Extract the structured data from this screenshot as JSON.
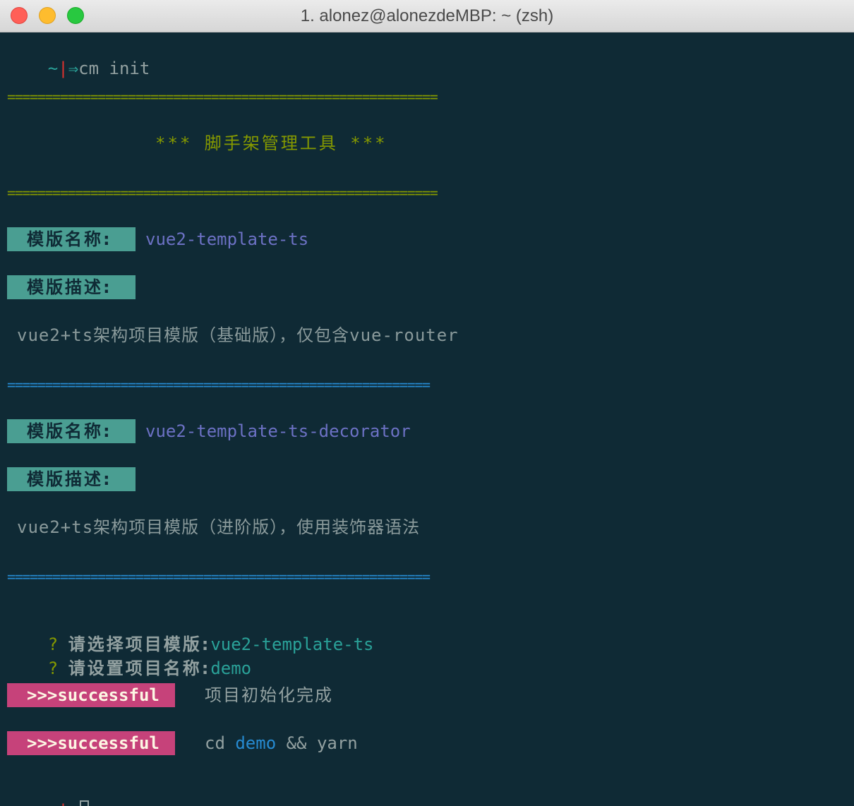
{
  "window": {
    "title": "1. alonez@alonezdeMBP: ~ (zsh)",
    "colors": {
      "background": "#0f2a35",
      "tag_bg": "#4a9e92",
      "success_bg": "#c6427a",
      "template_name": "#6c71c4",
      "separator_yellow": "#859900",
      "separator_blue": "#268bd2"
    }
  },
  "prompt": {
    "tilde": "~",
    "bar": "|",
    "arrow": "⇒"
  },
  "terminal": {
    "command": "cm init",
    "separator_top": "=========================================================",
    "banner": "*** 脚手架管理工具 ***",
    "separator_bottom": "=========================================================",
    "templates": [
      {
        "name_label": "模版名称:",
        "name": "vue2-template-ts",
        "desc_label": "模版描述:",
        "desc": "vue2+ts架构项目模版（基础版），仅包含vue-router"
      },
      {
        "name_label": "模版名称:",
        "name": "vue2-template-ts-decorator",
        "desc_label": "模版描述:",
        "desc": "vue2+ts架构项目模版（进阶版），使用装饰器语法"
      }
    ],
    "template_separator": "========================================================",
    "questions": [
      {
        "mark": "?",
        "text": "请选择项目模版:",
        "answer": "vue2-template-ts"
      },
      {
        "mark": "?",
        "text": "请设置项目名称:",
        "answer": "demo"
      }
    ],
    "results": [
      {
        "badge": ">>>successful",
        "message": "项目初始化完成"
      },
      {
        "badge": ">>>successful",
        "cmd_prefix": "cd ",
        "cmd_highlight": "demo",
        "cmd_suffix": " && yarn"
      }
    ]
  }
}
